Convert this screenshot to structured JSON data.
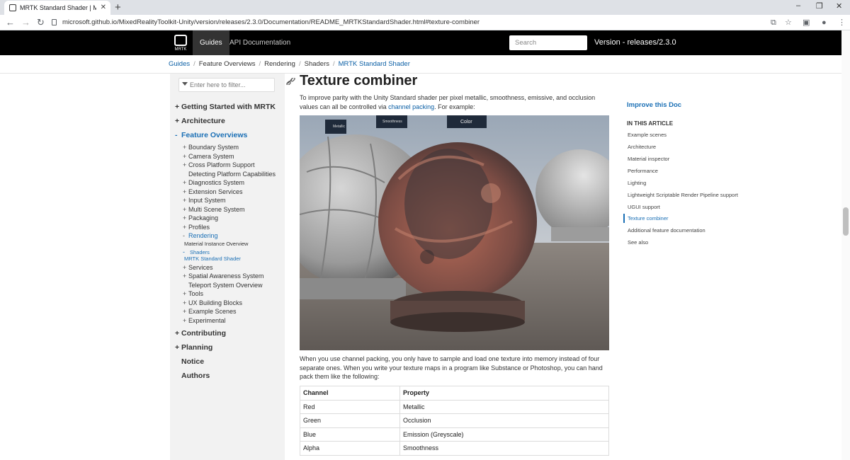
{
  "browser": {
    "tab_title": "MRTK Standard Shader | Mixed R",
    "tab_close": "✕",
    "new_tab": "+",
    "url": "microsoft.github.io/MixedRealityToolkit-Unity/version/releases/2.3.0/Documentation/README_MRTKStandardShader.html#texture-combiner",
    "minimize": "–",
    "maximize": "❐",
    "close_window": "✕",
    "back": "←",
    "forward": "→",
    "reload": "↻"
  },
  "header": {
    "logo_text": "MRTK",
    "nav": [
      "Guides",
      "API Documentation"
    ],
    "search_placeholder": "Search",
    "version": "Version - releases/2.3.0"
  },
  "breadcrumb": {
    "items": [
      "Guides",
      "Feature Overviews",
      "Rendering",
      "Shaders",
      "MRTK Standard Shader"
    ],
    "separator": "/"
  },
  "sidebar": {
    "filter_placeholder": "Enter here to filter...",
    "items": [
      {
        "level": 1,
        "pm": "+",
        "label": "Getting Started with MRTK"
      },
      {
        "level": 1,
        "pm": "+",
        "label": "Architecture"
      },
      {
        "level": 1,
        "pm": "-",
        "label": "Feature Overviews",
        "active": true
      },
      {
        "level": 2,
        "pm": "+",
        "label": "Boundary System"
      },
      {
        "level": 2,
        "pm": "+",
        "label": "Camera System"
      },
      {
        "level": 2,
        "pm": "+",
        "label": "Cross Platform Support"
      },
      {
        "level": 2,
        "pm": "",
        "label": "Detecting Platform Capabilities"
      },
      {
        "level": 2,
        "pm": "+",
        "label": "Diagnostics System"
      },
      {
        "level": 2,
        "pm": "+",
        "label": "Extension Services"
      },
      {
        "level": 2,
        "pm": "+",
        "label": "Input System"
      },
      {
        "level": 2,
        "pm": "+",
        "label": "Multi Scene System"
      },
      {
        "level": 2,
        "pm": "+",
        "label": "Packaging"
      },
      {
        "level": 2,
        "pm": "+",
        "label": "Profiles"
      },
      {
        "level": 2,
        "pm": "-",
        "label": "Rendering",
        "active": true
      },
      {
        "level": 3,
        "pm": "",
        "label": "Material Instance Overview"
      },
      {
        "level": 3,
        "pm": "-",
        "label": "Shaders",
        "active": true
      },
      {
        "level": 3,
        "pm": "",
        "label": "MRTK Standard Shader",
        "active": true
      },
      {
        "level": 2,
        "pm": "+",
        "label": "Services"
      },
      {
        "level": 2,
        "pm": "+",
        "label": "Spatial Awareness System"
      },
      {
        "level": 2,
        "pm": "",
        "label": "Teleport System Overview"
      },
      {
        "level": 2,
        "pm": "+",
        "label": "Tools"
      },
      {
        "level": 2,
        "pm": "+",
        "label": "UX Building Blocks"
      },
      {
        "level": 2,
        "pm": "+",
        "label": "Example Scenes"
      },
      {
        "level": 2,
        "pm": "+",
        "label": "Experimental"
      },
      {
        "level": 1,
        "pm": "+",
        "label": "Contributing"
      },
      {
        "level": 1,
        "pm": "+",
        "label": "Planning"
      },
      {
        "level": 1,
        "pm": "",
        "label": "Notice"
      },
      {
        "level": 1,
        "pm": "",
        "label": "Authors"
      }
    ]
  },
  "article": {
    "title": "Texture combiner",
    "intro_before": "To improve parity with the Unity Standard shader per pixel metallic, smoothness, emissive, and occlusion values can all be controlled via ",
    "intro_link": "channel packing",
    "intro_after": ". For example:",
    "figure_labels": [
      "Metallic",
      "Smoothness",
      "Color"
    ],
    "para2": "When you use channel packing, you only have to sample and load one texture into memory instead of four separate ones. When you write your texture maps in a program like Substance or Photoshop, you can hand pack them like the following:",
    "table": {
      "headers": [
        "Channel",
        "Property"
      ],
      "rows": [
        [
          "Red",
          "Metallic"
        ],
        [
          "Green",
          "Occlusion"
        ],
        [
          "Blue",
          "Emission (Greyscale)"
        ],
        [
          "Alpha",
          "Smoothness"
        ]
      ]
    }
  },
  "right_toc": {
    "improve": "Improve this Doc",
    "heading": "IN THIS ARTICLE",
    "items": [
      {
        "label": "Example scenes"
      },
      {
        "label": "Architecture"
      },
      {
        "label": "Material inspector"
      },
      {
        "label": "Performance"
      },
      {
        "label": "Lighting"
      },
      {
        "label": "Lightweight Scriptable Render Pipeline support"
      },
      {
        "label": "UGUI support"
      },
      {
        "label": "Texture combiner",
        "active": true
      },
      {
        "label": "Additional feature documentation"
      },
      {
        "label": "See also"
      }
    ]
  }
}
